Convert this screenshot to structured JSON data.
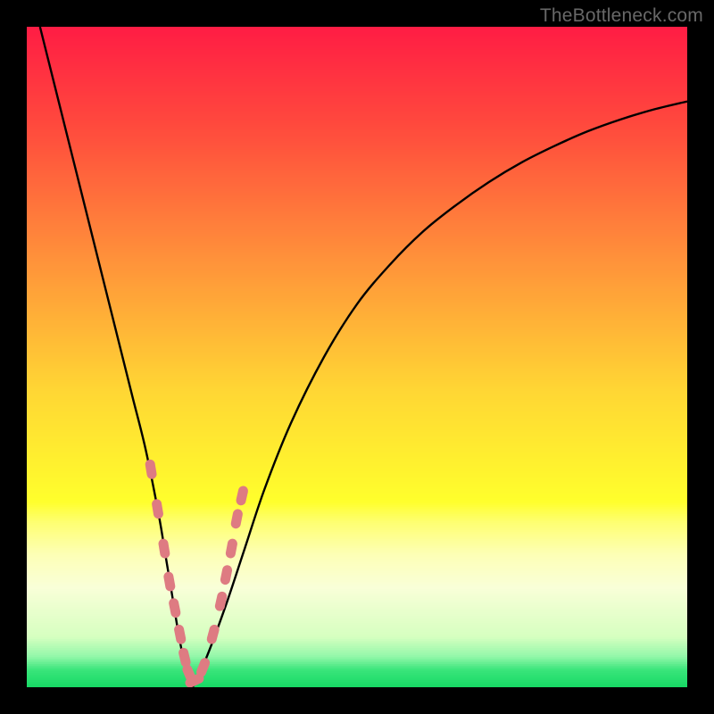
{
  "watermark": "TheBottleneck.com",
  "colors": {
    "frame": "#000000",
    "watermark": "#686868",
    "curve": "#000000",
    "marker": "#de7b82"
  },
  "chart_data": {
    "type": "line",
    "title": "",
    "xlabel": "",
    "ylabel": "",
    "xlim": [
      0,
      100
    ],
    "ylim": [
      0,
      100
    ],
    "grid": false,
    "legend": false,
    "annotations": [
      "TheBottleneck.com"
    ],
    "gradient_stops": [
      {
        "pos": 0.0,
        "color": "#ff1d44"
      },
      {
        "pos": 0.15,
        "color": "#ff4a3d"
      },
      {
        "pos": 0.35,
        "color": "#ff913a"
      },
      {
        "pos": 0.55,
        "color": "#ffd634"
      },
      {
        "pos": 0.72,
        "color": "#ffff2c"
      },
      {
        "pos": 0.75,
        "color": "#feff70"
      },
      {
        "pos": 0.8,
        "color": "#fdffb6"
      },
      {
        "pos": 0.85,
        "color": "#f9ffd8"
      },
      {
        "pos": 0.925,
        "color": "#d6ffc0"
      },
      {
        "pos": 0.955,
        "color": "#92f7a9"
      },
      {
        "pos": 0.975,
        "color": "#3ae57b"
      },
      {
        "pos": 1.0,
        "color": "#18d965"
      }
    ],
    "series": [
      {
        "name": "bottleneck-curve",
        "x": [
          2,
          4,
          6,
          8,
          10,
          12,
          14,
          16,
          18,
          20,
          21,
          22,
          23,
          24,
          25,
          27,
          30,
          33,
          36,
          40,
          45,
          50,
          55,
          60,
          65,
          70,
          75,
          80,
          85,
          90,
          95,
          100
        ],
        "y": [
          100,
          92,
          84,
          76,
          68,
          60,
          52,
          44,
          36,
          26,
          20,
          14,
          8,
          3,
          0,
          4,
          12,
          21,
          30,
          40,
          50,
          58,
          64,
          69,
          73,
          76.5,
          79.5,
          82,
          84.2,
          86,
          87.5,
          88.7
        ]
      }
    ],
    "markers": {
      "name": "highlighted-points",
      "x": [
        18.8,
        19.8,
        20.8,
        21.6,
        22.4,
        23.2,
        23.9,
        24.6,
        25.4,
        26.7,
        28.2,
        29.4,
        30.2,
        31.0,
        31.8,
        32.6
      ],
      "y": [
        33.0,
        27.0,
        21.0,
        16.0,
        12.0,
        8.0,
        4.5,
        2.0,
        1.0,
        3.0,
        8.0,
        13.0,
        17.0,
        21.0,
        25.5,
        29.0
      ]
    }
  }
}
